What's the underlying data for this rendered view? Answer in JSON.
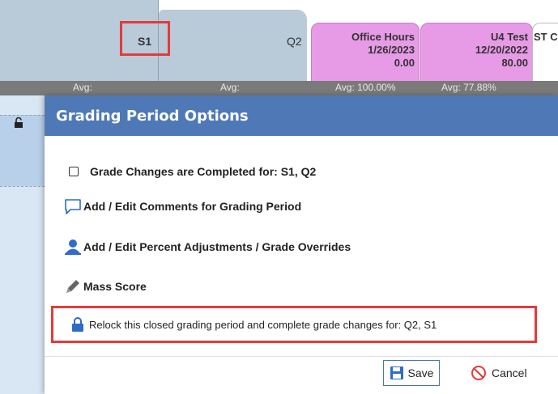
{
  "gradebook": {
    "columns": [
      {
        "label": "S1"
      },
      {
        "label": "Q2"
      },
      {
        "label": "Office Hours",
        "date": "1/26/2023",
        "points": "0.00"
      },
      {
        "label": "U4 Test",
        "date": "12/20/2022",
        "points": "80.00"
      },
      {
        "label": "ST C"
      }
    ],
    "averages": [
      "Avg:",
      "Avg:",
      "Avg: 100.00%",
      "Avg: 77.88%"
    ]
  },
  "dialog": {
    "title": "Grading Period Options",
    "grade_changes_label": "Grade Changes are Completed for: S1, Q2",
    "comments_label": "Add / Edit Comments for Grading Period",
    "adjustments_label": "Add / Edit Percent Adjustments / Grade Overrides",
    "mass_score_label": "Mass Score",
    "relock_label": "Relock this closed grading period and complete grade changes for: Q2, S1",
    "save_label": "Save",
    "cancel_label": "Cancel"
  },
  "colors": {
    "title_bar": "#4f79b6",
    "highlight": "#e23b3b",
    "pink_column": "#e79ae6",
    "blue_column": "#b9cad9"
  },
  "icons": {
    "comment": "comment-icon",
    "user": "user-icon",
    "pencil": "pencil-icon",
    "lock": "lock-icon",
    "save": "save-icon",
    "cancel": "cancel-icon"
  }
}
